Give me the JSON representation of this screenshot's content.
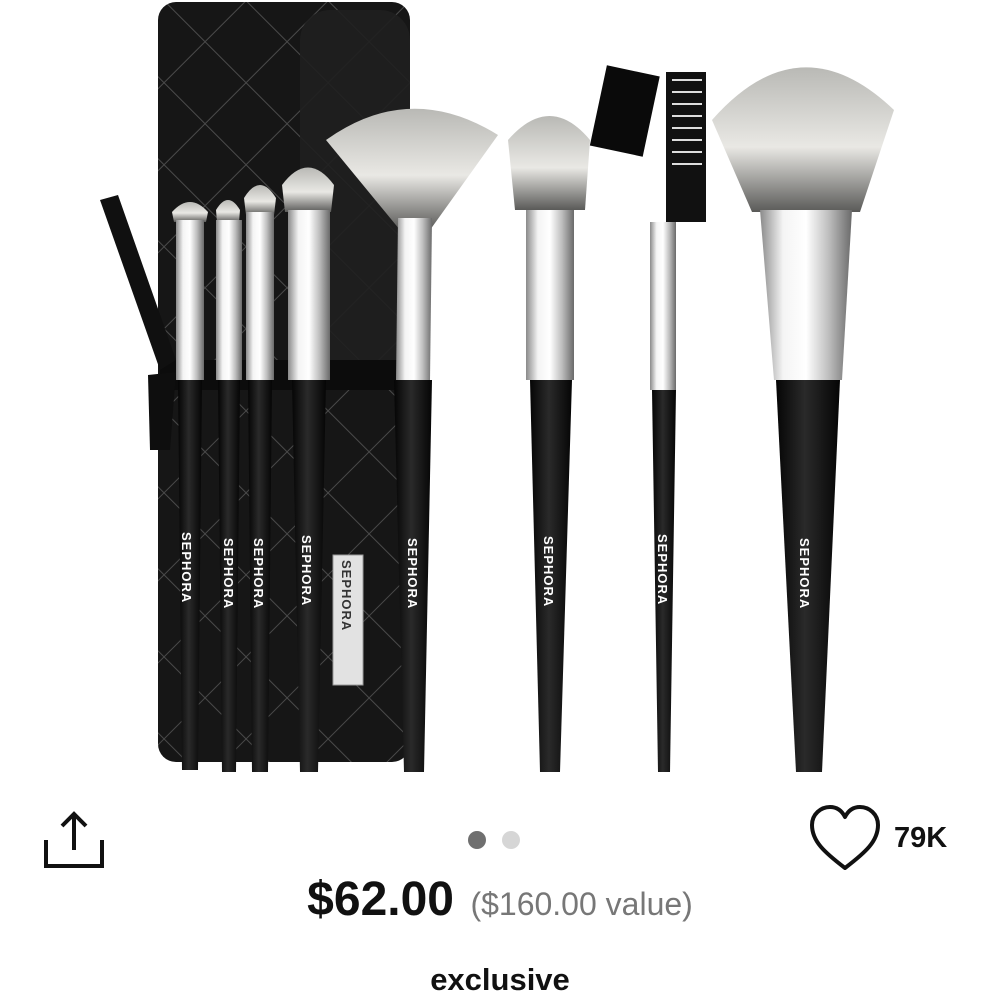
{
  "product": {
    "image_alt": "Sephora brush set with quilted black roll case",
    "brand_marks": [
      "SEPHORA",
      "SEPHORA",
      "SEPHORA",
      "SEPHORA",
      "SEPHORA",
      "SEPHORA",
      "SEPHORA",
      "SEPHORA",
      "SEPHORA"
    ],
    "price": "$62.00",
    "value_text": "($160.00 value)",
    "tag": "exclusive"
  },
  "actions": {
    "share_icon": "share-icon",
    "love_icon": "heart-icon",
    "loves_count": "79K"
  },
  "carousel": {
    "current_page": 1,
    "total_pages": 2
  },
  "colors": {
    "text": "#111111",
    "muted": "#777777",
    "dot_active": "#6f6f6f",
    "dot_inactive": "#d6d6d6"
  }
}
